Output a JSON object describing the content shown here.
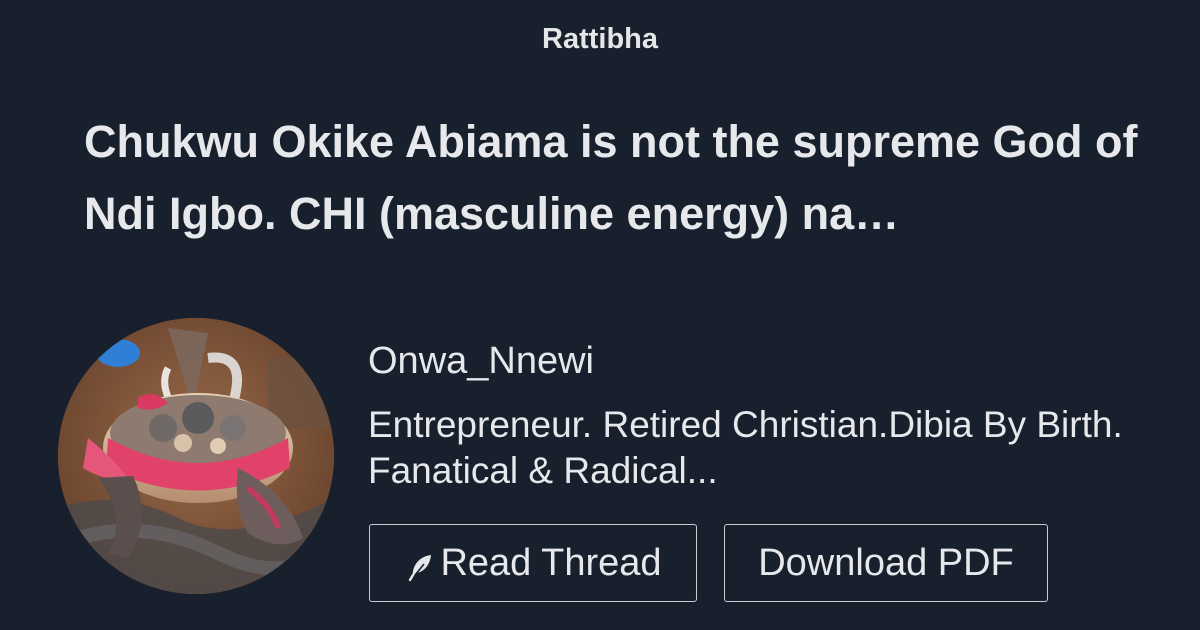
{
  "header": {
    "brand": "Rattibha"
  },
  "thread": {
    "title": "Chukwu Okike Abiama is not the supreme God of Ndi Igbo. CHI (masculine energy) na…"
  },
  "author": {
    "username": "Onwa_Nnewi",
    "bio": "Entrepreneur. Retired Christian.Dibia By Birth. Fanatical & Radical...",
    "avatar_icon": "profile-avatar"
  },
  "actions": {
    "read_label": "Read Thread",
    "read_icon": "feather-icon",
    "download_label": "Download PDF"
  },
  "colors": {
    "background": "#17202c",
    "text": "#e6e8eb",
    "button_border": "#c9ccd1"
  }
}
